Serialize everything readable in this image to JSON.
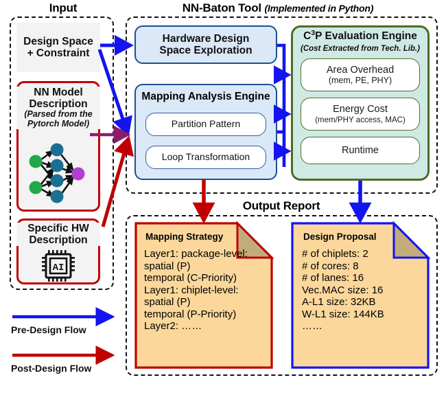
{
  "diagram": {
    "sections": {
      "input": {
        "title": "Input"
      },
      "tool": {
        "title": "NN-Baton Tool",
        "subtitle": "(Implemented in Python)"
      },
      "output": {
        "title": "Output Report"
      }
    },
    "input_cards": [
      {
        "name": "design-space-constraint",
        "title_line1": "Design Space",
        "title_line2": "+ Constraint",
        "border_color": "#1414f0"
      },
      {
        "name": "nn-model-description",
        "title_line1": "NN Model",
        "title_line2": "Description",
        "italic_line1": "(Parsed from the",
        "italic_line2": "Pytorch Model)",
        "graphic": "neural-network-graph-icon",
        "border_color": "#c00000"
      },
      {
        "name": "specific-hw-description",
        "title_line1": "Specific HW",
        "title_line2": "Description",
        "graphic": "ai-chip-icon",
        "chip_label": "AI",
        "border_color": "#c00000"
      }
    ],
    "tool_blocks": {
      "hardware_dse": {
        "line1": "Hardware Design",
        "line2": "Space Exploration"
      },
      "mapping_engine": {
        "title": "Mapping Analysis Engine",
        "items": [
          "Partition Pattern",
          "Loop Transformation"
        ]
      },
      "c3p_engine": {
        "title_prefix": "C",
        "title_sup": "3",
        "title_rest": "P Evaluation Engine",
        "subtitle": "(Cost Extracted from Tech. Lib.)",
        "items": [
          {
            "main": "Area Overhead",
            "sub": "(mem, PE, PHY)"
          },
          {
            "main": "Energy Cost",
            "sub": "(mem/PHY access, MAC)"
          },
          {
            "main": "Runtime",
            "sub": ""
          }
        ]
      }
    },
    "output_notes": [
      {
        "name": "mapping-strategy-note",
        "title": "Mapping Strategy",
        "border_color": "#c00000",
        "lines": [
          "Layer1: package-level:",
          "spatial (P)",
          "temporal (C-Priority)",
          "Layer1: chiplet-level:",
          "spatial (P)",
          "temporal (P-Priority)",
          "Layer2: ……"
        ]
      },
      {
        "name": "design-proposal-note",
        "title": "Design Proposal",
        "border_color": "#1414f0",
        "lines": [
          "# of chiplets: 2",
          "# of cores: 8",
          "# of lanes: 16",
          "Vec.MAC size: 16",
          "A-L1 size: 32KB",
          "W-L1 size: 144KB",
          "……"
        ]
      }
    ],
    "legend": [
      {
        "label": "Pre-Design Flow",
        "color": "#1414f0",
        "name": "legend-pre-design-flow"
      },
      {
        "label": "Post-Design Flow",
        "color": "#c00000",
        "name": "legend-post-design-flow"
      }
    ],
    "colors": {
      "pre_design_blue": "#1414f0",
      "post_design_red": "#c00000",
      "purple_arrow": "#8e1a6b",
      "blue_box_fill": "#dbe8f7",
      "blue_box_border": "#1d4f91",
      "green_box_fill": "#cfeae4",
      "green_box_border": "#4e6b27",
      "note_fill": "#fbd79b",
      "note_fold": "#c3ac7b"
    }
  }
}
